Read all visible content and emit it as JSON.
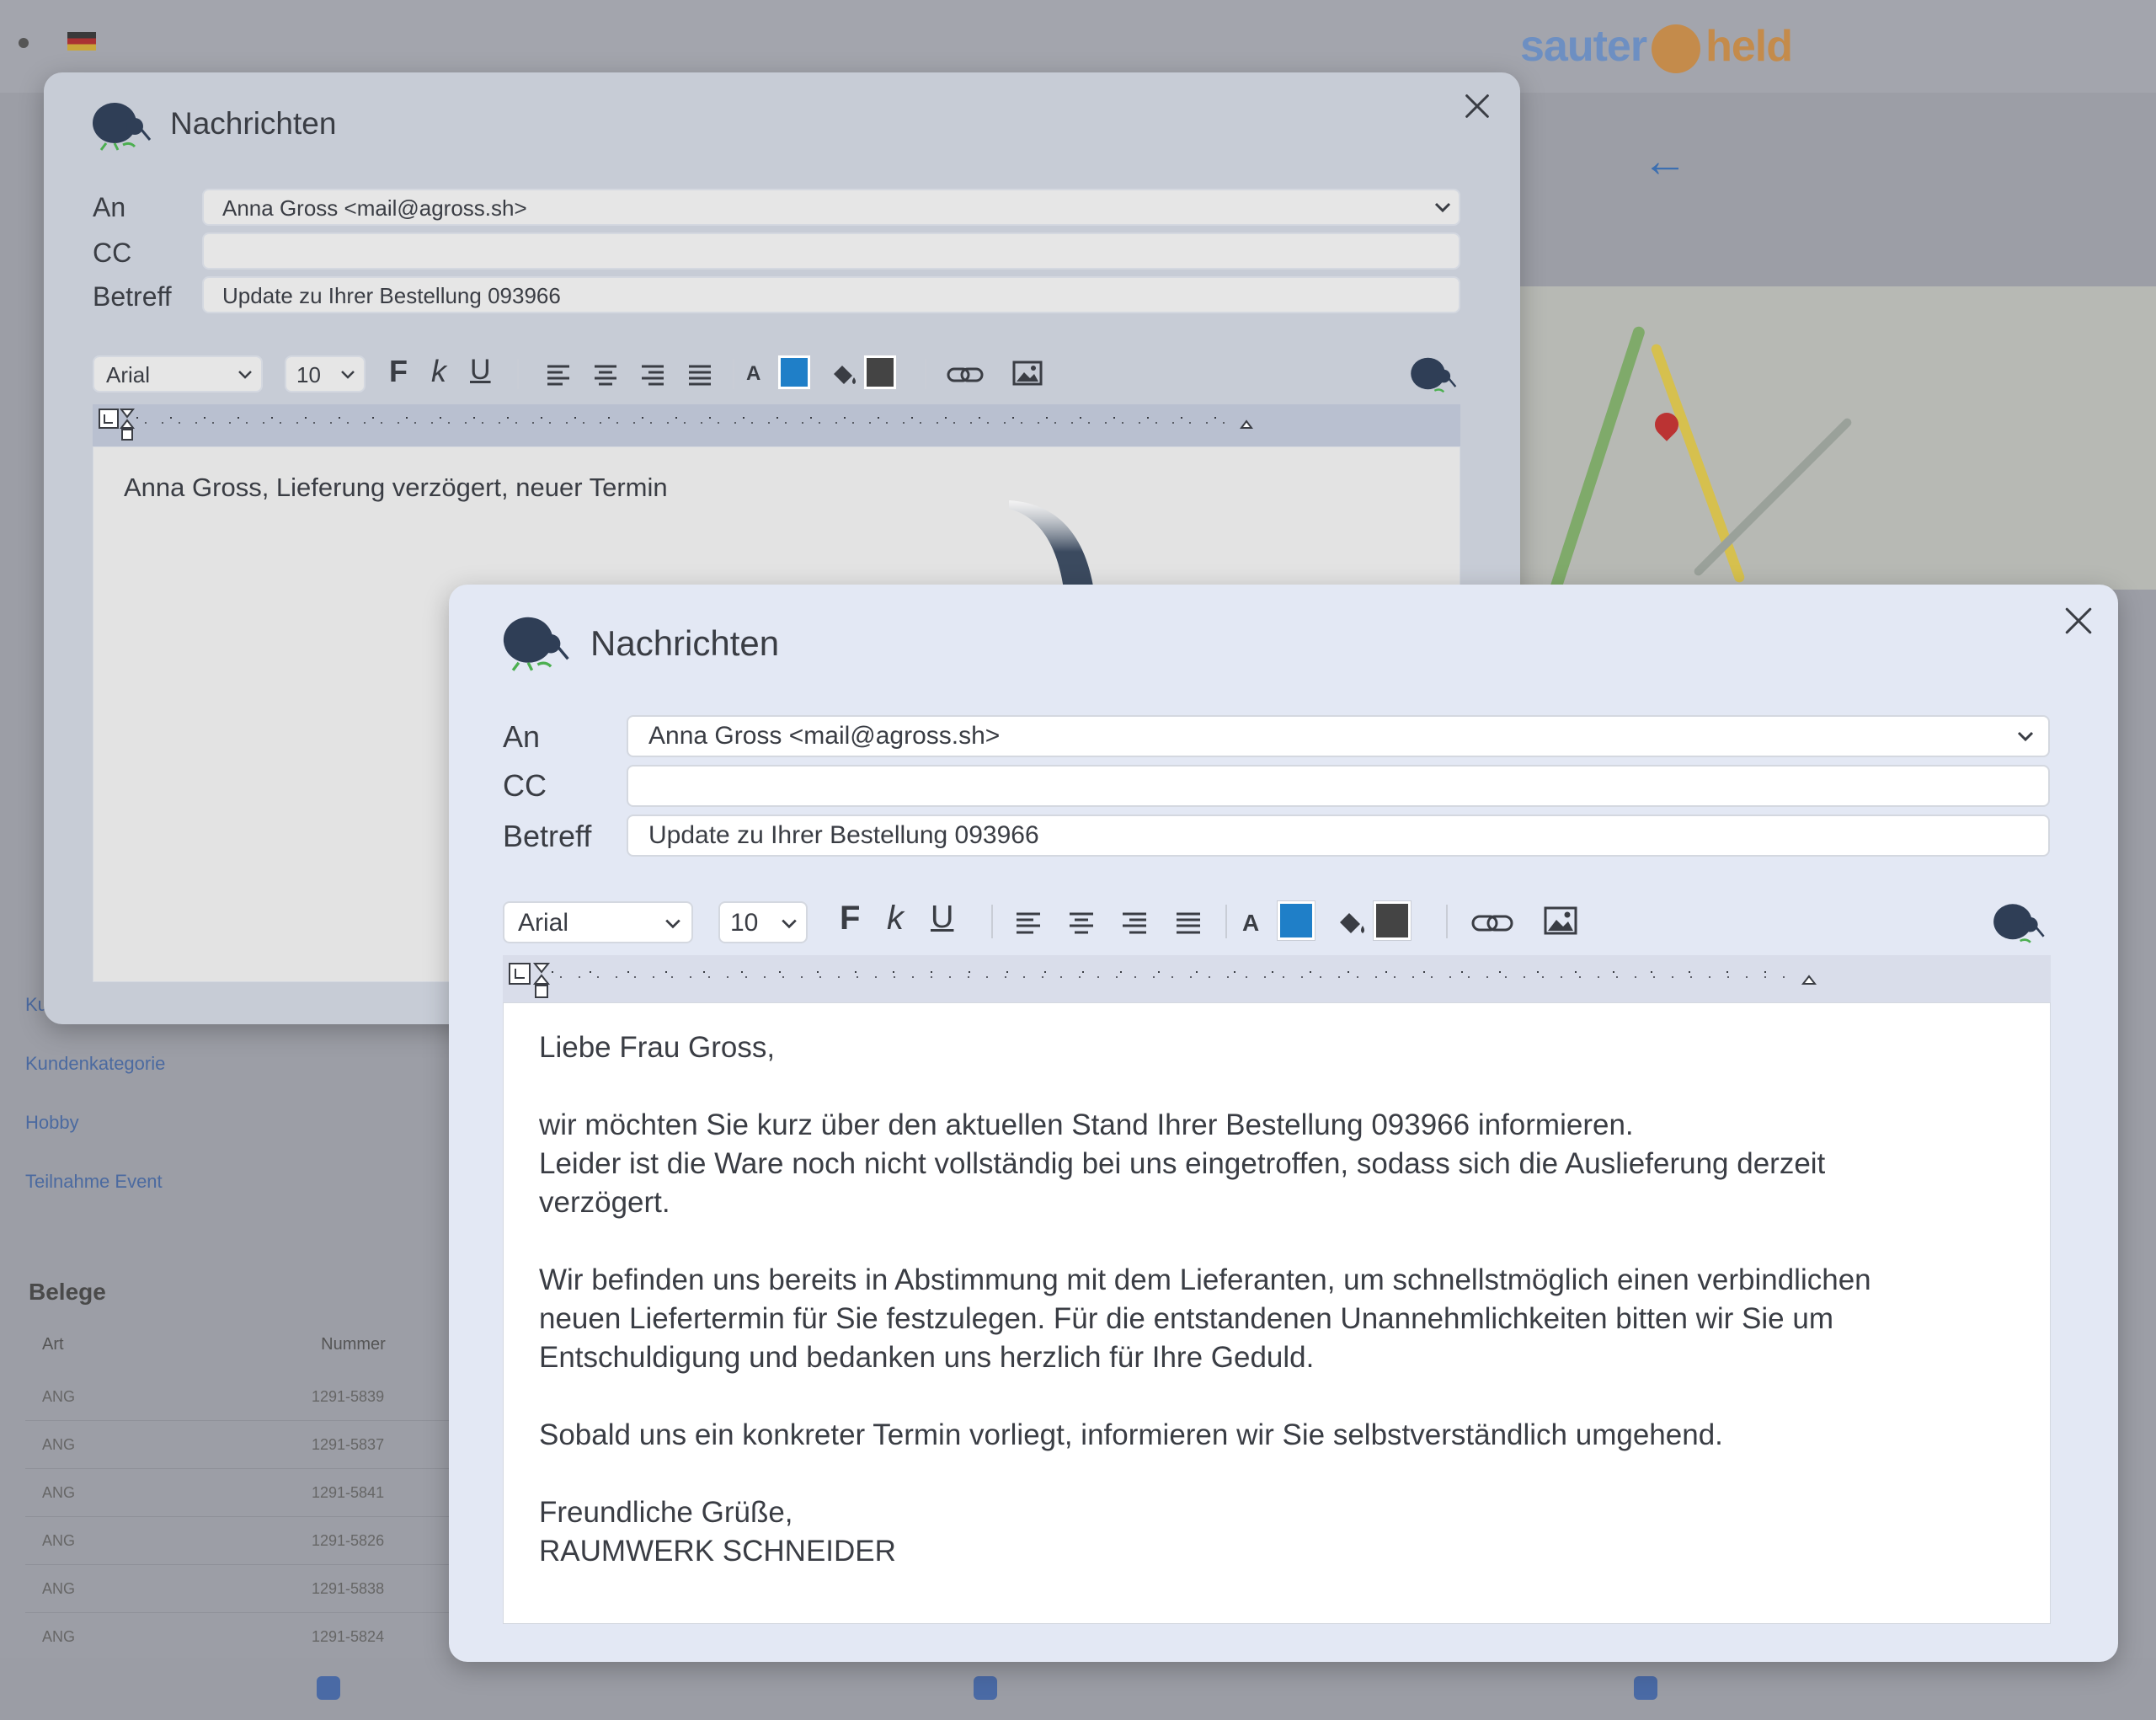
{
  "background": {
    "logo_left": "sauter",
    "logo_right": "held",
    "sidebar_items": [
      "Kundenart",
      "Kundenkategorie",
      "Hobby",
      "Teilnahme Event"
    ],
    "belege_title": "Belege",
    "table_headers": [
      "Art",
      "Nummer"
    ],
    "table_rows": [
      [
        "ANG",
        "1291-5839"
      ],
      [
        "ANG",
        "1291-5837"
      ],
      [
        "ANG",
        "1291-5841"
      ],
      [
        "ANG",
        "1291-5826"
      ],
      [
        "ANG",
        "1291-5838"
      ],
      [
        "ANG",
        "1291-5824"
      ]
    ]
  },
  "dialog_back": {
    "title": "Nachrichten",
    "to_label": "An",
    "cc_label": "CC",
    "subject_label": "Betreff",
    "to_value": "Anna Gross <mail@agross.sh>",
    "cc_value": "",
    "subject_value": "Update zu Ihrer Bestellung 093966",
    "font_value": "Arial",
    "size_value": "10",
    "bold_label": "F",
    "italic_label": "k",
    "underline_label": "U",
    "body_text": "Anna Gross, Lieferung verzögert, neuer Termin"
  },
  "dialog_front": {
    "title": "Nachrichten",
    "to_label": "An",
    "cc_label": "CC",
    "subject_label": "Betreff",
    "to_value": "Anna Gross <mail@agross.sh>",
    "cc_value": "",
    "subject_value": "Update zu Ihrer Bestellung 093966",
    "font_value": "Arial",
    "size_value": "10",
    "bold_label": "F",
    "italic_label": "k",
    "underline_label": "U",
    "body_lines": [
      "Liebe Frau Gross,",
      "",
      "wir möchten Sie kurz über den aktuellen Stand Ihrer Bestellung 093966 informieren.",
      "Leider ist die Ware noch nicht vollständig bei uns eingetroffen, sodass sich die Auslieferung derzeit",
      "verzögert.",
      "",
      "Wir befinden uns bereits in Abstimmung mit dem Lieferanten, um schnellstmöglich einen verbindlichen",
      "neuen Liefertermin für Sie festzulegen. Für die entstandenen Unannehmlichkeiten bitten wir Sie um",
      "Entschuldigung und bedanken uns herzlich für Ihre Geduld.",
      "",
      "Sobald uns ein konkreter Termin vorliegt, informieren wir Sie selbstverständlich umgehend.",
      "",
      "Freundliche Grüße,",
      "RAUMWERK SCHNEIDER"
    ]
  },
  "colors": {
    "text_color_swatch": "#1f7fc8",
    "highlight_swatch": "#444444",
    "arrow": "#3b4a5f",
    "kiwi": "#2f3e56",
    "kiwi_leaf": "#4caf50"
  },
  "icons": [
    "kiwi-bird-icon",
    "close-icon",
    "chevron-down-icon",
    "align-left-icon",
    "align-center-icon",
    "align-right-icon",
    "align-justify-icon",
    "text-color-icon",
    "highlight-color-icon",
    "link-icon",
    "image-icon",
    "ai-kiwi-icon"
  ]
}
